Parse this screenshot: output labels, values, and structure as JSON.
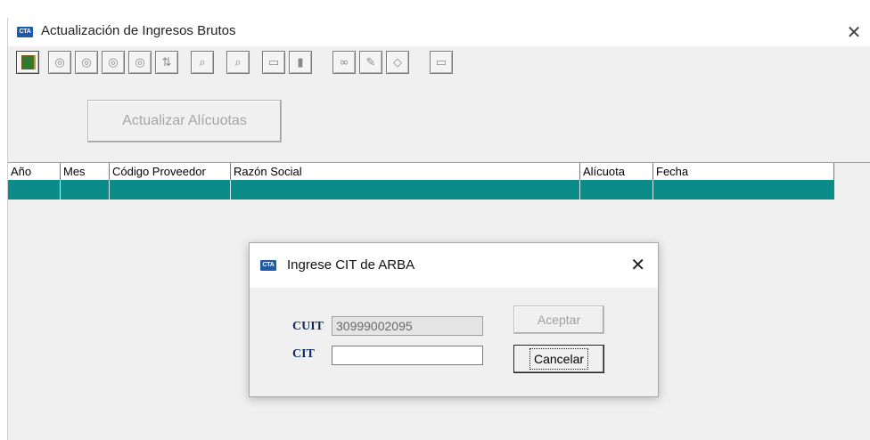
{
  "window": {
    "logo_text": "CTA",
    "title": "Actualización de Ingresos Brutos",
    "close_glyph": "✕"
  },
  "toolbar": {
    "icons": [
      "exit-icon",
      "first-record-icon",
      "previous-record-icon",
      "next-record-icon",
      "last-record-icon",
      "sort-icon",
      "binoculars-icon",
      "search-preview-icon",
      "save-icon",
      "delete-icon",
      "view-glasses-icon",
      "edit-pencil-icon",
      "eraser-icon",
      "print-icon"
    ]
  },
  "main": {
    "update_button_label": "Actualizar Alícuotas",
    "grid": {
      "columns": [
        "Año",
        "Mes",
        "Código Proveedor",
        "Razón Social",
        "Alícuota",
        "Fecha"
      ],
      "selected_row_color": "#0b8c88"
    }
  },
  "dialog": {
    "logo_text": "CTA",
    "title": "Ingrese CIT de ARBA",
    "close_glyph": "✕",
    "cuit_label": "CUIT",
    "cuit_value": "30999002095",
    "cit_label": "CIT",
    "cit_value": "",
    "accept_label": "Aceptar",
    "cancel_label": "Cancelar"
  }
}
